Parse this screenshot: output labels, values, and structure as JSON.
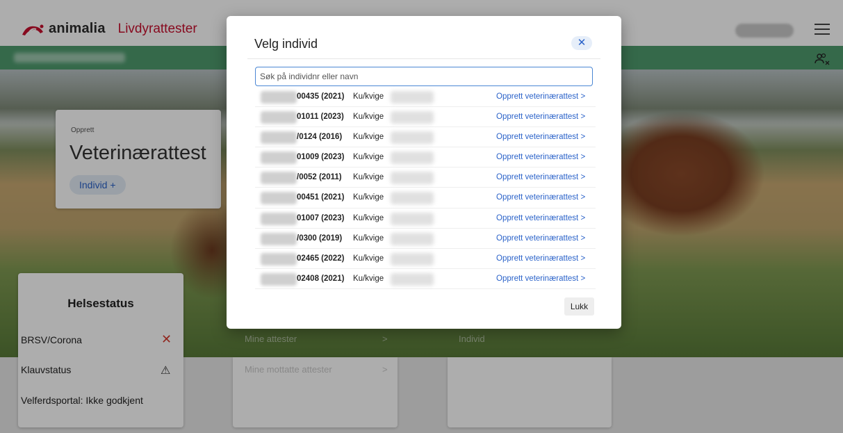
{
  "header": {
    "logo_text": "animalia",
    "product": "Livdyrattester"
  },
  "opprett_card": {
    "label": "Opprett",
    "title": "Veterinærattest",
    "chip": "Individ +"
  },
  "helsestatus": {
    "title": "Helsestatus",
    "rows": [
      {
        "label": "BRSV/Corona",
        "icon": "x-icon"
      },
      {
        "label": "Klauvstatus",
        "icon": "warning-icon"
      },
      {
        "label": "Velferdsportal: Ikke godkjent",
        "icon": ""
      }
    ]
  },
  "mine_card": {
    "items": [
      "Mine attester",
      "Mine mottatte attester"
    ],
    "chevron": ">"
  },
  "individ_card": {
    "label": "Individ"
  },
  "modal": {
    "title": "Velg individ",
    "close_label": "✕",
    "search_placeholder": "Søk på individnr eller navn",
    "link_label": "Opprett veterinærattest >",
    "rows": [
      {
        "id": "00435 (2021)",
        "type": "Ku/kvige"
      },
      {
        "id": "01011 (2023)",
        "type": "Ku/kvige"
      },
      {
        "id": "/0124 (2016)",
        "type": "Ku/kvige"
      },
      {
        "id": "01009 (2023)",
        "type": "Ku/kvige"
      },
      {
        "id": "/0052 (2011)",
        "type": "Ku/kvige"
      },
      {
        "id": "00451 (2021)",
        "type": "Ku/kvige"
      },
      {
        "id": "01007 (2023)",
        "type": "Ku/kvige"
      },
      {
        "id": "/0300 (2019)",
        "type": "Ku/kvige"
      },
      {
        "id": "02465 (2022)",
        "type": "Ku/kvige"
      },
      {
        "id": "02408 (2021)",
        "type": "Ku/kvige"
      }
    ],
    "close_button": "Lukk"
  },
  "colors": {
    "brand_red": "#c8102e",
    "green_bar": "#4e9b6e",
    "link_blue": "#2a62c9"
  }
}
